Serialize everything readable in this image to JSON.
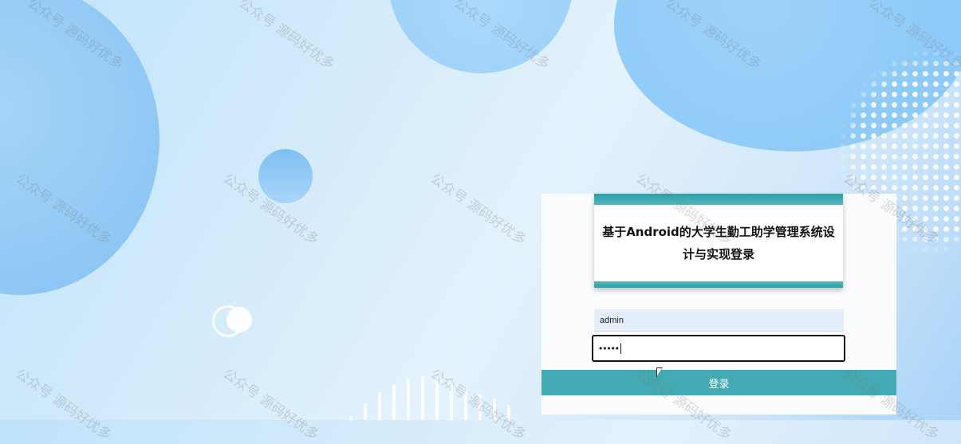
{
  "login": {
    "title": "基于Android的大学生勤工助学管理系统设计与实现登录",
    "username_value": "admin",
    "password_value": "•••••",
    "submit_label": "登录"
  },
  "watermark": {
    "text": "公众号 源码好优多"
  },
  "colors": {
    "accent": "#43aab3",
    "title_band": "#2d9fa6",
    "input_fill": "#e4edfa"
  }
}
